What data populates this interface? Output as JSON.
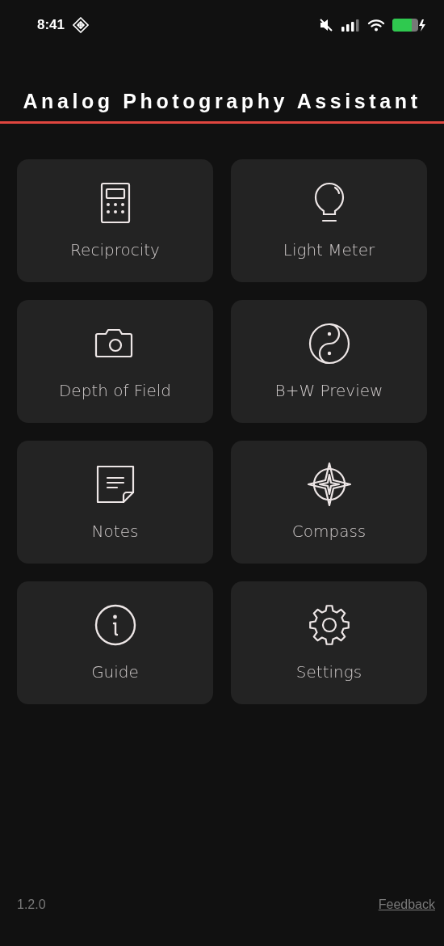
{
  "status_bar": {
    "time": "8:41"
  },
  "title": "Analog Photography Assistant",
  "tiles": [
    {
      "label": "Reciprocity"
    },
    {
      "label": "Light Meter"
    },
    {
      "label": "Depth of Field"
    },
    {
      "label": "B+W Preview"
    },
    {
      "label": "Notes"
    },
    {
      "label": "Compass"
    },
    {
      "label": "Guide"
    },
    {
      "label": "Settings"
    }
  ],
  "footer": {
    "version": "1.2.0",
    "link": "Feedback"
  }
}
